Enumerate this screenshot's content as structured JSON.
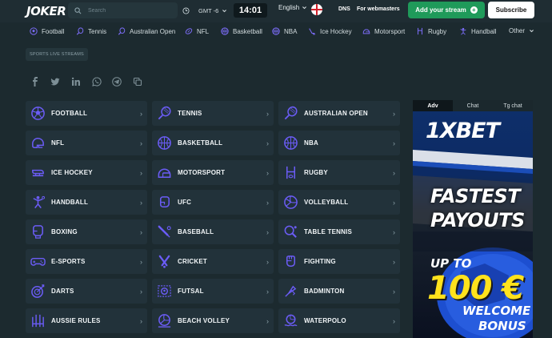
{
  "header": {
    "logo": "JOKER",
    "search_placeholder": "Search",
    "timezone": "GMT -6",
    "clock": "14:01",
    "language": "English",
    "dns": "DNS",
    "webmasters": "For webmasters",
    "add_stream": "Add your stream",
    "subscribe": "Subscribe"
  },
  "nav": [
    {
      "label": "Football",
      "icon": "football-icon"
    },
    {
      "label": "Tennis",
      "icon": "tennis-icon"
    },
    {
      "label": "Australian Open",
      "icon": "tennis-icon"
    },
    {
      "label": "NFL",
      "icon": "american-football-icon"
    },
    {
      "label": "Basketball",
      "icon": "basketball-icon"
    },
    {
      "label": "NBA",
      "icon": "basketball-icon"
    },
    {
      "label": "Ice Hockey",
      "icon": "hockey-icon"
    },
    {
      "label": "Motorsport",
      "icon": "helmet-icon"
    },
    {
      "label": "Rugby",
      "icon": "rugby-icon"
    },
    {
      "label": "Handball",
      "icon": "handball-icon"
    },
    {
      "label": "Other",
      "icon": "chevron-down-icon"
    }
  ],
  "breadcrumb": "SPORTS LIVE STREAMS",
  "social": [
    "facebook-icon",
    "twitter-icon",
    "linkedin-icon",
    "whatsapp-icon",
    "telegram-icon",
    "copy-icon"
  ],
  "sports": [
    [
      "FOOTBALL",
      "TENNIS",
      "AUSTRALIAN OPEN"
    ],
    [
      "NFL",
      "BASKETBALL",
      "NBA"
    ],
    [
      "ICE HOCKEY",
      "MOTORSPORT",
      "RUGBY"
    ],
    [
      "HANDBALL",
      "UFC",
      "VOLLEYBALL"
    ],
    [
      "BOXING",
      "BASEBALL",
      "TABLE TENNIS"
    ],
    [
      "E-SPORTS",
      "CRICKET",
      "FIGHTING"
    ],
    [
      "DARTS",
      "FUTSAL",
      "BADMINTON"
    ],
    [
      "AUSSIE RULES",
      "BEACH VOLLEY",
      "WATERPOLO"
    ]
  ],
  "sidebar": {
    "tabs": [
      "Adv",
      "Chat",
      "Tg chat"
    ],
    "ad": {
      "brand": "1XBET",
      "line1": "FASTEST",
      "line2": "PAYOUTS",
      "upto": "UP TO",
      "amount": "100 €",
      "line3": "WELCOME",
      "line4": "BONUS"
    }
  },
  "colors": {
    "accent_icon": "#6b5cf6",
    "stream_button": "#1f9a5a",
    "ad_yellow": "#ffe21c"
  }
}
